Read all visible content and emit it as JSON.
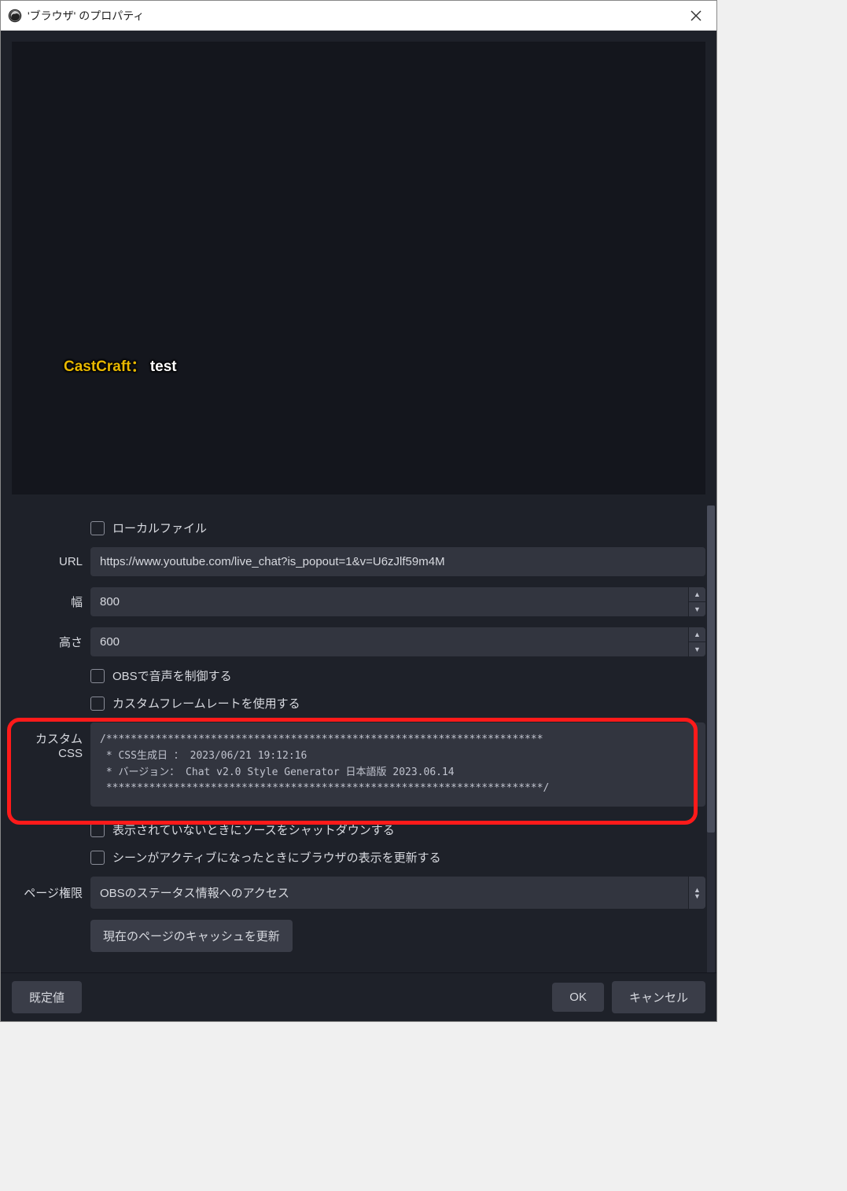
{
  "titlebar": {
    "title": "'ブラウザ' のプロパティ"
  },
  "preview": {
    "name": "CastCraft：",
    "message": "test"
  },
  "form": {
    "local_file_label": "ローカルファイル",
    "url_label": "URL",
    "url_value": "https://www.youtube.com/live_chat?is_popout=1&v=U6zJlf59m4M",
    "width_label": "幅",
    "width_value": "800",
    "height_label": "高さ",
    "height_value": "600",
    "obs_audio_label": "OBSで音声を制御する",
    "custom_fps_label": "カスタムフレームレートを使用する",
    "custom_css_label": "カスタム CSS",
    "custom_css_value": "/***********************************************************************\n * CSS生成日 ： 2023/06/21 19:12:16\n * バージョン： Chat v2.0 Style Generator 日本語版 2023.06.14\n ***********************************************************************/",
    "shutdown_label": "表示されていないときにソースをシャットダウンする",
    "refresh_on_active_label": "シーンがアクティブになったときにブラウザの表示を更新する",
    "page_perm_label": "ページ権限",
    "page_perm_value": "OBSのステータス情報へのアクセス",
    "refresh_cache_button": "現在のページのキャッシュを更新"
  },
  "footer": {
    "defaults": "既定値",
    "ok": "OK",
    "cancel": "キャンセル"
  }
}
